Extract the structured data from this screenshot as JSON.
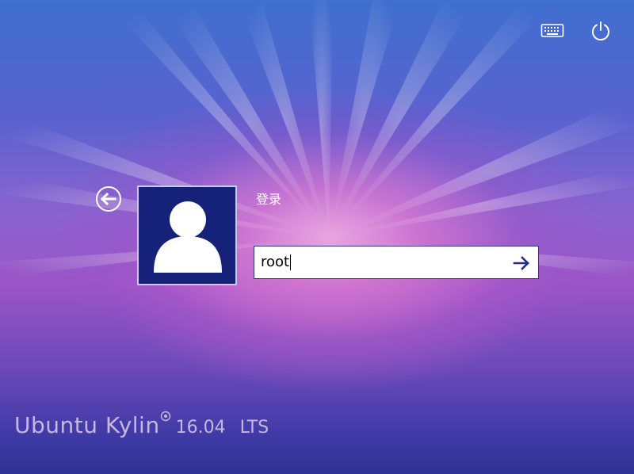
{
  "topbar": {
    "keyboard_icon": "keyboard-icon",
    "power_icon": "power-icon"
  },
  "login": {
    "title": "登录",
    "back_icon": "back-arrow-icon",
    "avatar_icon": "user-avatar-icon",
    "password_value": "root",
    "submit_icon": "arrow-right-icon"
  },
  "brand": {
    "name": "Ubuntu Kylin",
    "version": "16.04",
    "edition": "LTS"
  },
  "colors": {
    "avatar_bg": "#16217a",
    "input_border": "#2b3a8c",
    "accent": "#1f2b8f"
  }
}
